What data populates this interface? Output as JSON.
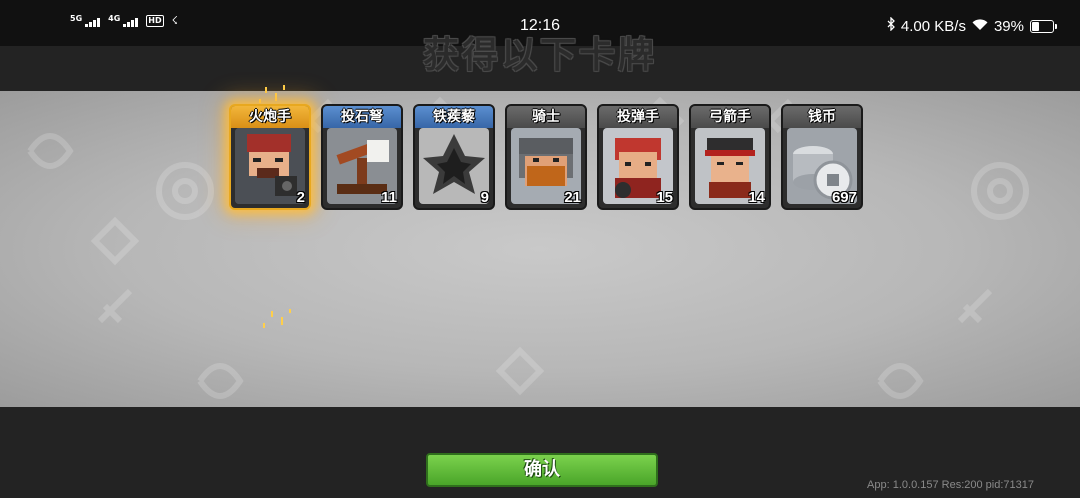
{
  "status_bar": {
    "signal_1_label": "5G",
    "signal_2_label": "4G",
    "hd_label": "HD",
    "time": "12:16",
    "bluetooth_icon": "bluetooth-icon",
    "net_speed": "4.00 KB/s",
    "wifi_icon": "wifi-icon",
    "battery_percent": "39%",
    "battery_level": 0.39
  },
  "title": "获得以下卡牌",
  "cards": [
    {
      "name": "火炮手",
      "count": "2",
      "frame": "gold",
      "icon": "cannoneer-portrait"
    },
    {
      "name": "投石弩",
      "count": "11",
      "frame": "blue",
      "icon": "catapult-portrait"
    },
    {
      "name": "铁蒺藜",
      "count": "9",
      "frame": "blue",
      "icon": "caltrop-portrait"
    },
    {
      "name": "骑士",
      "count": "21",
      "frame": "gray",
      "icon": "knight-portrait"
    },
    {
      "name": "投弹手",
      "count": "15",
      "frame": "gray",
      "icon": "bomber-portrait"
    },
    {
      "name": "弓箭手",
      "count": "14",
      "frame": "gray",
      "icon": "archer-portrait"
    },
    {
      "name": "钱币",
      "count": "697",
      "frame": "gray",
      "icon": "coins-icon"
    }
  ],
  "confirm_label": "确认",
  "version_text": "App: 1.0.0.157 Res:200 pid:71317",
  "colors": {
    "gold_frame": "#e8a81f",
    "blue_header": "#3766a7",
    "confirm_green": "#4aa529",
    "panel_bg": "#bdbdbd"
  }
}
